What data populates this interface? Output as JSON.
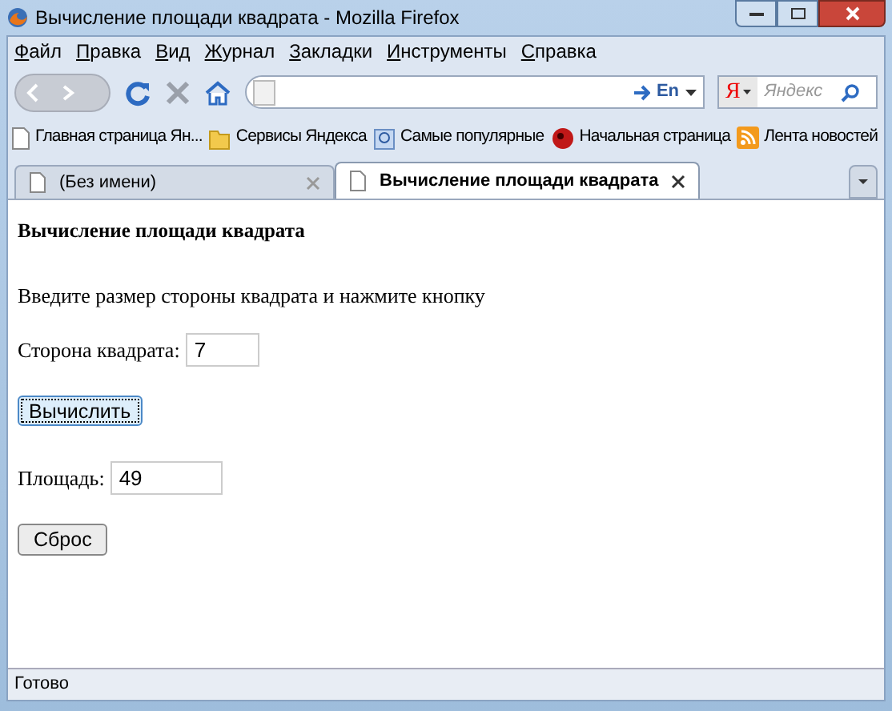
{
  "window": {
    "title": "Вычисление площади квадрата - Mozilla Firefox"
  },
  "menu": [
    "Файл",
    "Правка",
    "Вид",
    "Журнал",
    "Закладки",
    "Инструменты",
    "Справка"
  ],
  "address_bar": {
    "language": "En"
  },
  "search": {
    "engine": "Я",
    "placeholder": "Яндекс"
  },
  "bookmarks": [
    {
      "label": "Главная страница Ян...",
      "kind": "page"
    },
    {
      "label": "Сервисы Яндекса",
      "kind": "folder"
    },
    {
      "label": "Самые популярные",
      "kind": "smart"
    },
    {
      "label": "Начальная страница",
      "kind": "fox"
    },
    {
      "label": "Лента новостей",
      "kind": "feed"
    }
  ],
  "tabs": [
    {
      "label": "(Без имени)",
      "selected": false
    },
    {
      "label": "Вычисление площади квадрата",
      "selected": true
    }
  ],
  "page": {
    "heading": "Вычисление площади квадрата",
    "instruction": "Введите размер стороны квадрата и нажмите кнопку",
    "side_label": "Сторона квадрата:",
    "side_value": "7",
    "calculate_button": "Вычислить",
    "area_label": "Площадь:",
    "area_value": "49",
    "reset_button": "Сброс"
  },
  "status_bar": "Готово"
}
